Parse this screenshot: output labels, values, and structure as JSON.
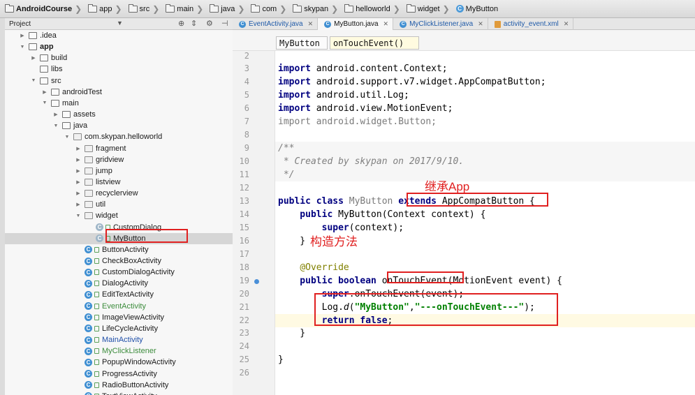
{
  "breadcrumb": [
    "AndroidCourse",
    "app",
    "src",
    "main",
    "java",
    "com",
    "skypan",
    "helloworld",
    "widget",
    "MyButton"
  ],
  "project_panel": {
    "title": "Project",
    "tree": [
      {
        "label": ".idea",
        "indent": 1,
        "icon": "folder",
        "arrow": "right"
      },
      {
        "label": "app",
        "indent": 1,
        "icon": "folder",
        "arrow": "down",
        "bold": true
      },
      {
        "label": "build",
        "indent": 2,
        "icon": "folder",
        "arrow": "right"
      },
      {
        "label": "libs",
        "indent": 2,
        "icon": "folder",
        "arrow": ""
      },
      {
        "label": "src",
        "indent": 2,
        "icon": "folder",
        "arrow": "down"
      },
      {
        "label": "androidTest",
        "indent": 3,
        "icon": "folder",
        "arrow": "right"
      },
      {
        "label": "main",
        "indent": 3,
        "icon": "folder",
        "arrow": "down"
      },
      {
        "label": "assets",
        "indent": 4,
        "icon": "folder",
        "arrow": "right"
      },
      {
        "label": "java",
        "indent": 4,
        "icon": "folder",
        "arrow": "down"
      },
      {
        "label": "com.skypan.helloworld",
        "indent": 5,
        "icon": "package",
        "arrow": "down"
      },
      {
        "label": "fragment",
        "indent": 6,
        "icon": "package",
        "arrow": "right"
      },
      {
        "label": "gridview",
        "indent": 6,
        "icon": "package",
        "arrow": "right"
      },
      {
        "label": "jump",
        "indent": 6,
        "icon": "package",
        "arrow": "right"
      },
      {
        "label": "listview",
        "indent": 6,
        "icon": "package",
        "arrow": "right"
      },
      {
        "label": "recyclerview",
        "indent": 6,
        "icon": "package",
        "arrow": "right"
      },
      {
        "label": "util",
        "indent": 6,
        "icon": "package",
        "arrow": "right"
      },
      {
        "label": "widget",
        "indent": 6,
        "icon": "package",
        "arrow": "down"
      },
      {
        "label": "CustomDialog",
        "indent": 7,
        "icon": "class",
        "arrow": ""
      },
      {
        "label": "MyButton",
        "indent": 7,
        "icon": "class",
        "arrow": "",
        "selected": true
      },
      {
        "label": "ButtonActivity",
        "indent": 6,
        "icon": "class",
        "arrow": ""
      },
      {
        "label": "CheckBoxActivity",
        "indent": 6,
        "icon": "class",
        "arrow": ""
      },
      {
        "label": "CustomDialogActivity",
        "indent": 6,
        "icon": "class",
        "arrow": ""
      },
      {
        "label": "DialogActivity",
        "indent": 6,
        "icon": "class",
        "arrow": ""
      },
      {
        "label": "EditTextActivity",
        "indent": 6,
        "icon": "class",
        "arrow": ""
      },
      {
        "label": "EventActivity",
        "indent": 6,
        "icon": "class",
        "arrow": "",
        "color": "green"
      },
      {
        "label": "ImageViewActivity",
        "indent": 6,
        "icon": "class",
        "arrow": ""
      },
      {
        "label": "LifeCycleActivity",
        "indent": 6,
        "icon": "class",
        "arrow": ""
      },
      {
        "label": "MainActivity",
        "indent": 6,
        "icon": "class",
        "arrow": "",
        "color": "blue"
      },
      {
        "label": "MyClickListener",
        "indent": 6,
        "icon": "class",
        "arrow": "",
        "color": "green"
      },
      {
        "label": "PopupWindowActivity",
        "indent": 6,
        "icon": "class",
        "arrow": ""
      },
      {
        "label": "ProgressActivity",
        "indent": 6,
        "icon": "class",
        "arrow": ""
      },
      {
        "label": "RadioButtonActivity",
        "indent": 6,
        "icon": "class",
        "arrow": ""
      },
      {
        "label": "TextViewActivity",
        "indent": 6,
        "icon": "class",
        "arrow": ""
      }
    ]
  },
  "tabs": [
    {
      "label": "EventActivity.java",
      "icon": "class"
    },
    {
      "label": "MyButton.java",
      "icon": "class",
      "active": true
    },
    {
      "label": "MyClickListener.java",
      "icon": "class"
    },
    {
      "label": "activity_event.xml",
      "icon": "xml"
    }
  ],
  "editor_breadcrumb": {
    "class_name": "MyButton",
    "method_name": "onTouchEvent()"
  },
  "code": {
    "line_numbers": [
      "2",
      "3",
      "4",
      "5",
      "6",
      "7",
      "8",
      "9",
      "10",
      "11",
      "12",
      "13",
      "14",
      "15",
      "16",
      "17",
      "18",
      "19",
      "20",
      "21",
      "22",
      "23",
      "24",
      "25",
      "26"
    ],
    "lines": [
      [],
      [
        {
          "t": "import ",
          "c": "kw"
        },
        {
          "t": "android.content.Context;"
        }
      ],
      [
        {
          "t": "import ",
          "c": "kw"
        },
        {
          "t": "android.support.v7.widget.AppCompatButton;"
        }
      ],
      [
        {
          "t": "import ",
          "c": "kw"
        },
        {
          "t": "android.util.Log;"
        }
      ],
      [
        {
          "t": "import ",
          "c": "kw"
        },
        {
          "t": "android.view.MotionEvent;"
        }
      ],
      [
        {
          "t": "import ",
          "c": "gr"
        },
        {
          "t": "android.widget.Button;",
          "c": "gr"
        }
      ],
      [],
      [
        {
          "t": "/**",
          "c": "cm"
        }
      ],
      [
        {
          "t": " * Created by skypan on 2017/9/10.",
          "c": "cm"
        }
      ],
      [
        {
          "t": " */",
          "c": "cm"
        }
      ],
      [],
      [
        {
          "t": "public class ",
          "c": "kw"
        },
        {
          "t": "MyButton ",
          "c": "gr"
        },
        {
          "t": "extends ",
          "c": "kw"
        },
        {
          "t": "AppCompatButton {"
        }
      ],
      [
        {
          "t": "    public ",
          "c": "kw"
        },
        {
          "t": "MyButton(Context context) {"
        }
      ],
      [
        {
          "t": "        "
        },
        {
          "t": "super",
          "c": "kw"
        },
        {
          "t": "(context);"
        }
      ],
      [
        {
          "t": "    }"
        }
      ],
      [],
      [
        {
          "t": "    "
        },
        {
          "t": "@Override",
          "c": "an"
        }
      ],
      [
        {
          "t": "    public boolean ",
          "c": "kw"
        },
        {
          "t": "onTouchEvent(MotionEvent event) {"
        }
      ],
      [
        {
          "t": "        "
        },
        {
          "t": "super",
          "c": "kw"
        },
        {
          "t": ".onTouchEvent(event);"
        }
      ],
      [
        {
          "t": "        Log."
        },
        {
          "t": "d",
          "c": "ital"
        },
        {
          "t": "("
        },
        {
          "t": "\"MyButton\"",
          "c": "st"
        },
        {
          "t": ","
        },
        {
          "t": "\"---onTouchEvent---\"",
          "c": "st"
        },
        {
          "t": ");"
        }
      ],
      [
        {
          "t": "        return false",
          "c": "kw"
        },
        {
          "t": ";"
        }
      ],
      [
        {
          "t": "    }"
        }
      ],
      [],
      [
        {
          "t": "}"
        }
      ],
      []
    ]
  },
  "annotations": {
    "extends_note": "继承App",
    "constructor_note": "构造方法"
  },
  "colors": {
    "annotation_red": "#e02020",
    "keyword": "#000080",
    "string": "#008000",
    "comment": "#808080"
  }
}
